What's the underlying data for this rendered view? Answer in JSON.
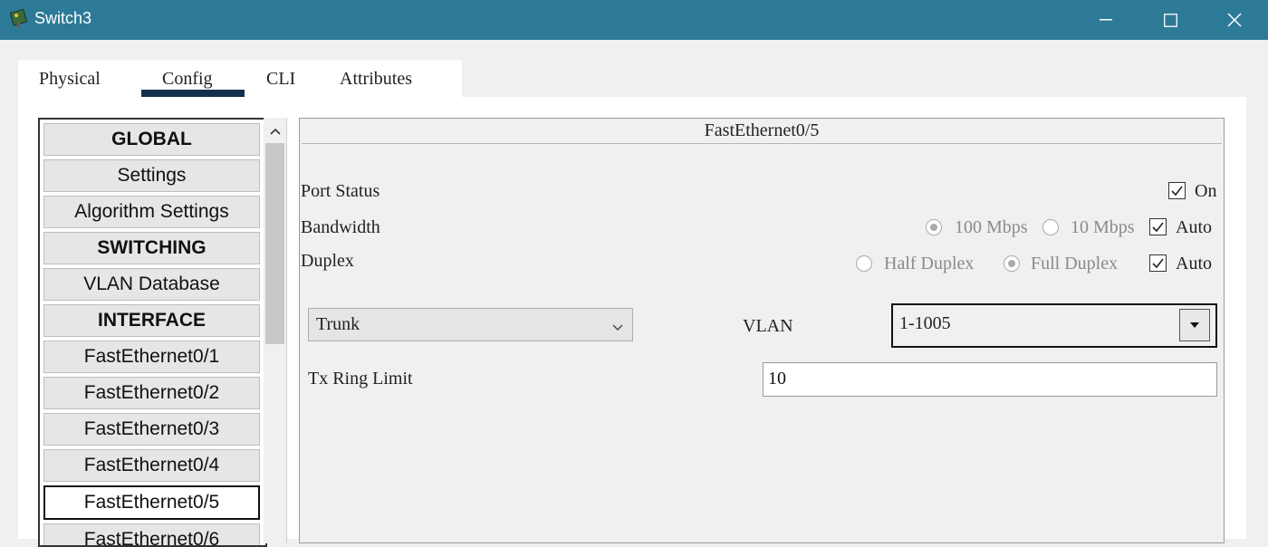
{
  "window": {
    "title": "Switch3"
  },
  "tabs": [
    {
      "label": "Physical"
    },
    {
      "label": "Config"
    },
    {
      "label": "CLI"
    },
    {
      "label": "Attributes"
    }
  ],
  "active_tab": "Config",
  "nav": {
    "items": [
      {
        "label": "GLOBAL",
        "header": true
      },
      {
        "label": "Settings"
      },
      {
        "label": "Algorithm Settings"
      },
      {
        "label": "SWITCHING",
        "header": true
      },
      {
        "label": "VLAN Database"
      },
      {
        "label": "INTERFACE",
        "header": true
      },
      {
        "label": "FastEthernet0/1"
      },
      {
        "label": "FastEthernet0/2"
      },
      {
        "label": "FastEthernet0/3"
      },
      {
        "label": "FastEthernet0/4"
      },
      {
        "label": "FastEthernet0/5",
        "selected": true
      },
      {
        "label": "FastEthernet0/6"
      }
    ]
  },
  "panel": {
    "title": "FastEthernet0/5",
    "port_status": {
      "label": "Port Status",
      "on_label": "On",
      "on_checked": true
    },
    "bandwidth": {
      "label": "Bandwidth",
      "options": [
        "100 Mbps",
        "10 Mbps"
      ],
      "selected": "100 Mbps",
      "auto_label": "Auto",
      "auto_checked": true
    },
    "duplex": {
      "label": "Duplex",
      "options": [
        "Half Duplex",
        "Full Duplex"
      ],
      "selected": "Full Duplex",
      "auto_label": "Auto",
      "auto_checked": true
    },
    "mode_select": {
      "value": "Trunk"
    },
    "vlan": {
      "label": "VLAN",
      "value": "1-1005"
    },
    "tx_ring": {
      "label": "Tx Ring Limit",
      "value": "10"
    }
  },
  "colors": {
    "titlebar": "#2d7a97",
    "tab_underline": "#12304d"
  }
}
